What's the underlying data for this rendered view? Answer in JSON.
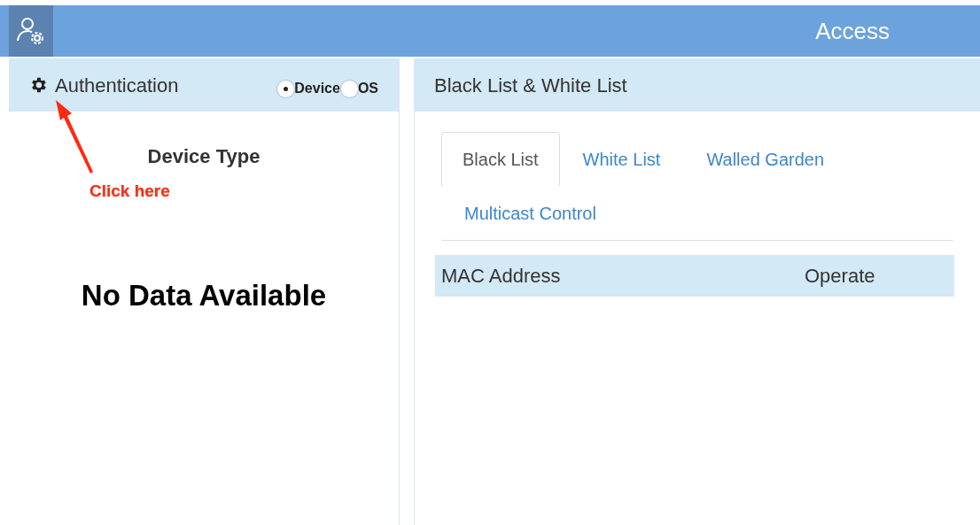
{
  "header": {
    "title": "Access"
  },
  "auth_panel": {
    "title": "Authentication",
    "radios": [
      {
        "label": "Device",
        "selected": true
      },
      {
        "label": "OS",
        "selected": false
      }
    ],
    "subtitle": "Device Type",
    "empty_message": "No Data Available"
  },
  "annotation": {
    "label": "Click here"
  },
  "list_panel": {
    "title": "Black List & White List",
    "tabs": [
      {
        "label": "Black List",
        "selected": true
      },
      {
        "label": "White List",
        "selected": false
      },
      {
        "label": "Walled Garden",
        "selected": false
      },
      {
        "label": "Multicast Control",
        "selected": false
      }
    ],
    "table": {
      "columns": [
        "MAC Address",
        "Operate"
      ]
    }
  }
}
